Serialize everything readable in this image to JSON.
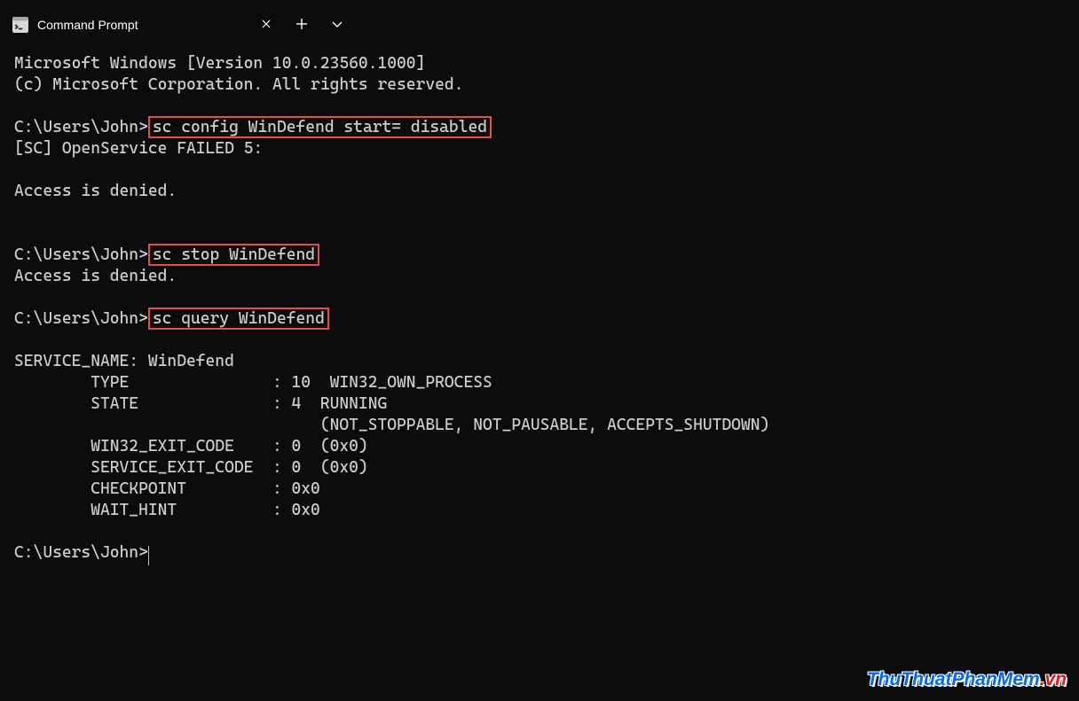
{
  "tab": {
    "title": "Command Prompt"
  },
  "terminal": {
    "banner_line1": "Microsoft Windows [Version 10.0.23560.1000]",
    "banner_line2": "(c) Microsoft Corporation. All rights reserved.",
    "prompt": "C:\\Users\\John>",
    "cmd1": "sc config WinDefend start= disabled",
    "out1_line1": "[SC] OpenService FAILED 5:",
    "out1_line2": "Access is denied.",
    "cmd2": "sc stop WinDefend",
    "out2_line1": "Access is denied.",
    "cmd3": "sc query WinDefend",
    "q_service_name": "SERVICE_NAME: WinDefend",
    "q_type": "        TYPE               : 10  WIN32_OWN_PROCESS",
    "q_state": "        STATE              : 4  RUNNING",
    "q_state2": "                                (NOT_STOPPABLE, NOT_PAUSABLE, ACCEPTS_SHUTDOWN)",
    "q_w32": "        WIN32_EXIT_CODE    : 0  (0x0)",
    "q_svc": "        SERVICE_EXIT_CODE  : 0  (0x0)",
    "q_chk": "        CHECKPOINT         : 0x0",
    "q_wait": "        WAIT_HINT          : 0x0"
  },
  "watermark": {
    "main": "ThuThuatPhanMem",
    "ext": ".vn"
  }
}
